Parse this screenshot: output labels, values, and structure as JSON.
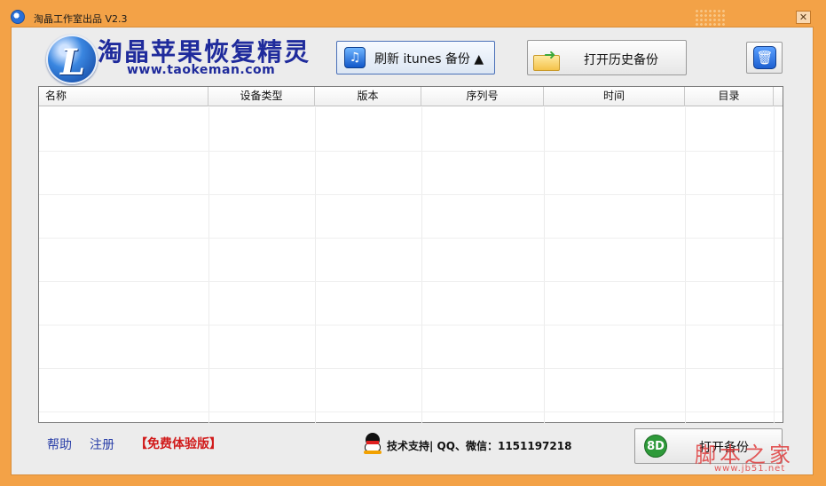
{
  "window": {
    "title": "淘晶工作室出品 V2.3",
    "close_label": "✕"
  },
  "brand": {
    "name": "淘晶苹果恢复精灵",
    "url": "www.taokeman.com",
    "logo_letter": "L"
  },
  "toolbar": {
    "refresh_label": "刷新 itunes 备份 ▲",
    "refresh_icon": "music-note-icon",
    "history_label": "打开历史备份",
    "history_icon": "folder-icon",
    "trash_icon": "trash-icon"
  },
  "table": {
    "columns": [
      "名称",
      "设备类型",
      "版本",
      "序列号",
      "时间",
      "目录"
    ],
    "rows": []
  },
  "footer": {
    "help": "帮助",
    "register": "注册",
    "trial": "【免费体验版】",
    "support": "技术支持| QQ、微信：1151197218",
    "open_backup": "打开备份",
    "open_icon_text": "8D"
  },
  "watermark": {
    "text": "脚本之家",
    "sub": "www.jb51.net"
  },
  "colors": {
    "frame": "#f3a247",
    "brand_text": "#1f2b9c",
    "link": "#2a3fa8",
    "trial": "#d11a1a",
    "watermark": "#e03c3c"
  }
}
